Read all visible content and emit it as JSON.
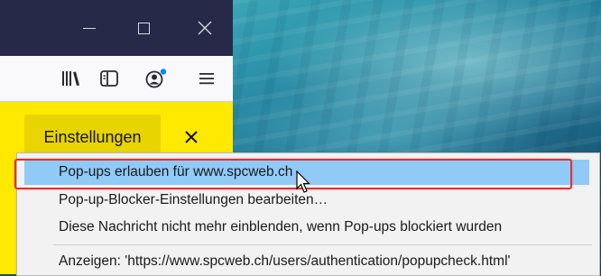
{
  "window": {
    "controls": {
      "minimize_icon": "minimize-icon",
      "maximize_icon": "maximize-icon",
      "close_icon": "close-icon"
    }
  },
  "toolbar": {
    "icons": [
      "library-icon",
      "reader-view-icon",
      "account-icon",
      "menu-icon"
    ],
    "account_badge_color": "#0a84ff"
  },
  "notification": {
    "settings_label": "Einstellungen",
    "close_icon": "close-icon",
    "background": "#ffe900"
  },
  "menu": {
    "items": [
      {
        "label": "Pop-ups erlauben für www.spcweb.ch",
        "highlighted": true
      },
      {
        "label": "Pop-up-Blocker-Einstellungen bearbeiten…"
      },
      {
        "label": "Diese Nachricht nicht mehr einblenden, wenn Pop-ups blockiert wurden"
      },
      {
        "label": "Anzeigen: 'https://www.spcweb.ch/users/authentication/popupcheck.html'"
      }
    ],
    "highlight_color": "#91c9f7",
    "annotation_color": "#e2312d"
  }
}
